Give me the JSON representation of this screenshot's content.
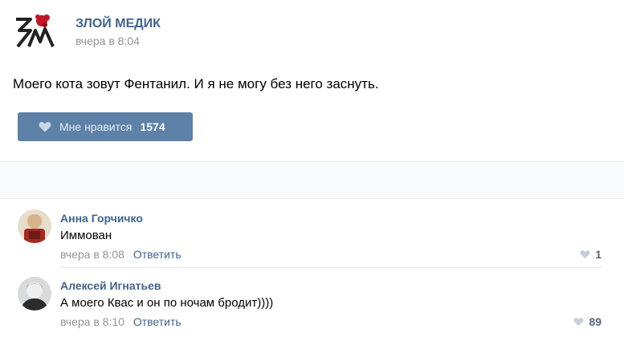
{
  "post": {
    "group_name": "ЗЛОЙ МЕДИК",
    "time": "вчера в 8:04",
    "text": "Моего кота зовут Фентанил. И я не могу без него заснуть.",
    "like_label": "Мне нравится",
    "like_count": "1574"
  },
  "comments": [
    {
      "author": "Анна Горчичко",
      "text": "Иммован",
      "time": "вчера в 8:08",
      "reply_label": "Ответить",
      "likes": "1"
    },
    {
      "author": "Алексей Игнатьев",
      "text": "А моего Квас и он по ночам бродит))))",
      "time": "вчера в 8:10",
      "reply_label": "Ответить",
      "likes": "89"
    }
  ],
  "colors": {
    "link": "#42648b",
    "like_button": "#5e81a8",
    "muted": "#939393"
  }
}
